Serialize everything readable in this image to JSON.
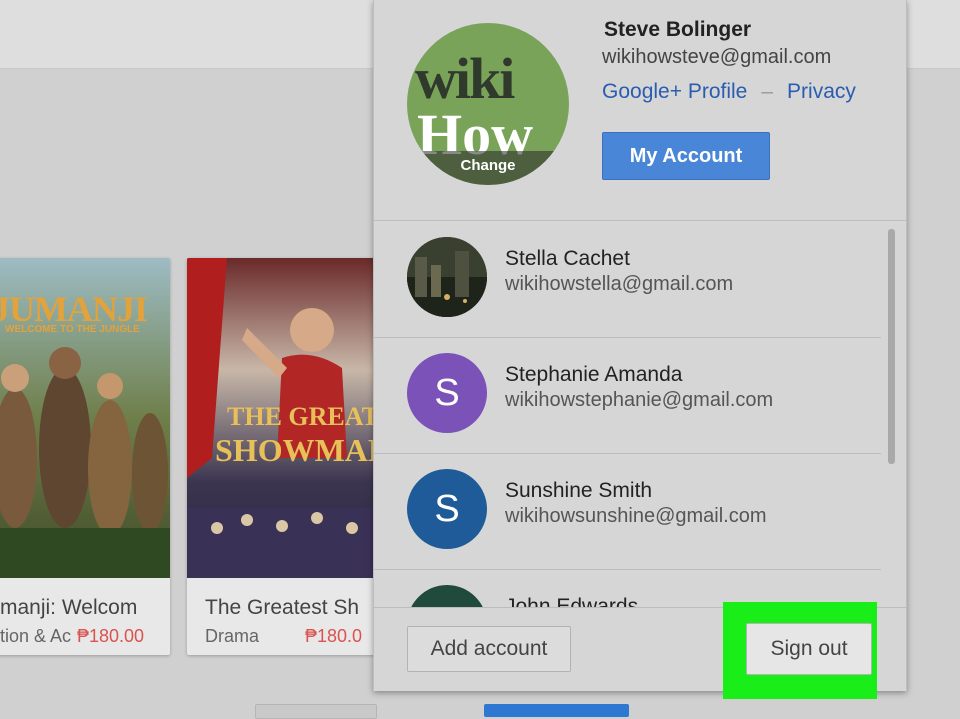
{
  "background_cards": [
    {
      "title": "manji: Welcom",
      "genre": "tion & Ac",
      "price": "₱180.00"
    },
    {
      "title": "The Greatest Sh",
      "genre": "Drama",
      "price": "₱180.0"
    }
  ],
  "posters": [
    {
      "text_line1": "JUMANJI",
      "text_line2": "WELCOME TO THE JUNGLE"
    },
    {
      "text_line1": "THE GREATEST",
      "text_line2": "SHOWMAN"
    }
  ],
  "popup": {
    "current_account": {
      "name": "Steve Bolinger",
      "email": "wikihowsteve@gmail.com",
      "avatar_text_top": "wiki",
      "avatar_text_bottom": "How",
      "avatar_change_label": "Change",
      "profile_link": "Google+ Profile",
      "separator": "–",
      "privacy_link": "Privacy",
      "my_account_button": "My Account"
    },
    "other_accounts": [
      {
        "name": "Stella Cachet",
        "email": "wikihowstella@gmail.com",
        "initial": "",
        "color": "#2e3a2c"
      },
      {
        "name": "Stephanie Amanda",
        "email": "wikihowstephanie@gmail.com",
        "initial": "S",
        "color": "#7b52b8"
      },
      {
        "name": "Sunshine Smith",
        "email": "wikihowsunshine@gmail.com",
        "initial": "S",
        "color": "#1f5a99"
      },
      {
        "name": "John Edwards",
        "email": "",
        "initial": "",
        "color": "#1f4a3c"
      }
    ],
    "add_account_button": "Add account",
    "sign_out_button": "Sign out"
  },
  "colors": {
    "highlight": "#19ee19",
    "primary_button": "#4a86d8",
    "link": "#2a5db0",
    "price": "#d9534f"
  }
}
